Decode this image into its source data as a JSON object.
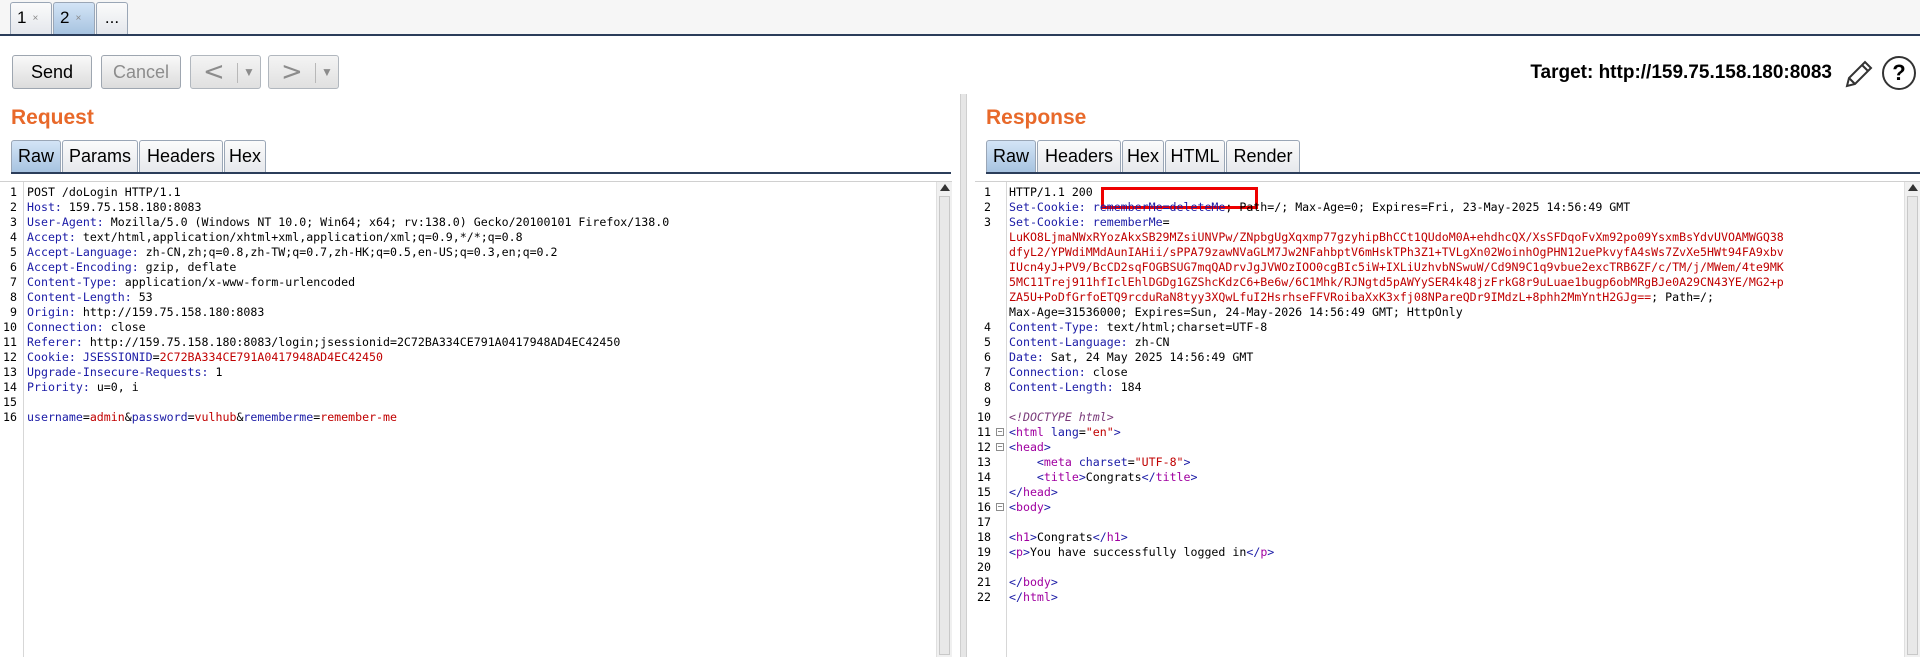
{
  "tabs": [
    {
      "label": "1",
      "close": "×"
    },
    {
      "label": "2",
      "close": "×"
    },
    {
      "label": "..."
    }
  ],
  "toolbar": {
    "send_label": "Send",
    "cancel_label": "Cancel",
    "back_arrow": "<",
    "forward_arrow": ">",
    "dropdown_glyph": "▼",
    "target_label": "Target: http://159.75.158.180:8083",
    "help_glyph": "?"
  },
  "request": {
    "title": "Request",
    "tabs": [
      "Raw",
      "Params",
      "Headers",
      "Hex"
    ],
    "active_tab": "Raw",
    "lines": [
      {
        "n": "1",
        "segments": [
          {
            "t": "POST /doLogin HTTP/1.1",
            "c": "hval"
          }
        ]
      },
      {
        "n": "2",
        "segments": [
          {
            "t": "Host: ",
            "c": "hname"
          },
          {
            "t": "159.75.158.180:8083",
            "c": "hval"
          }
        ]
      },
      {
        "n": "3",
        "segments": [
          {
            "t": "User-Agent: ",
            "c": "hname"
          },
          {
            "t": "Mozilla/5.0 (Windows NT 10.0; Win64; x64; rv:138.0) Gecko/20100101 Firefox/138.0",
            "c": "hval"
          }
        ]
      },
      {
        "n": "4",
        "segments": [
          {
            "t": "Accept: ",
            "c": "hname"
          },
          {
            "t": "text/html,application/xhtml+xml,application/xml;q=0.9,*/*;q=0.8",
            "c": "hval"
          }
        ]
      },
      {
        "n": "5",
        "segments": [
          {
            "t": "Accept-Language: ",
            "c": "hname"
          },
          {
            "t": "zh-CN,zh;q=0.8,zh-TW;q=0.7,zh-HK;q=0.5,en-US;q=0.3,en;q=0.2",
            "c": "hval"
          }
        ]
      },
      {
        "n": "6",
        "segments": [
          {
            "t": "Accept-Encoding: ",
            "c": "hname"
          },
          {
            "t": "gzip, deflate",
            "c": "hval"
          }
        ]
      },
      {
        "n": "7",
        "segments": [
          {
            "t": "Content-Type: ",
            "c": "hname"
          },
          {
            "t": "application/x-www-form-urlencoded",
            "c": "hval"
          }
        ]
      },
      {
        "n": "8",
        "segments": [
          {
            "t": "Content-Length: ",
            "c": "hname"
          },
          {
            "t": "53",
            "c": "hval"
          }
        ]
      },
      {
        "n": "9",
        "segments": [
          {
            "t": "Origin: ",
            "c": "hname"
          },
          {
            "t": "http://159.75.158.180:8083",
            "c": "hval"
          }
        ]
      },
      {
        "n": "10",
        "segments": [
          {
            "t": "Connection: ",
            "c": "hname"
          },
          {
            "t": "close",
            "c": "hval"
          }
        ]
      },
      {
        "n": "11",
        "segments": [
          {
            "t": "Referer: ",
            "c": "hname"
          },
          {
            "t": "http://159.75.158.180:8083/login;jsessionid=2C72BA334CE791A0417948AD4EC42450",
            "c": "hval"
          }
        ]
      },
      {
        "n": "12",
        "segments": [
          {
            "t": "Cookie: ",
            "c": "hname"
          },
          {
            "t": "JSESSIONID",
            "c": "blue"
          },
          {
            "t": "=",
            "c": "hval"
          },
          {
            "t": "2C72BA334CE791A0417948AD4EC42450",
            "c": "red"
          }
        ]
      },
      {
        "n": "13",
        "segments": [
          {
            "t": "Upgrade-Insecure-Requests: ",
            "c": "hname"
          },
          {
            "t": "1",
            "c": "hval"
          }
        ]
      },
      {
        "n": "14",
        "segments": [
          {
            "t": "Priority: ",
            "c": "hname"
          },
          {
            "t": "u=0, i",
            "c": "hval"
          }
        ]
      },
      {
        "n": "15",
        "segments": []
      },
      {
        "n": "16",
        "segments": [
          {
            "t": "username",
            "c": "blue"
          },
          {
            "t": "=",
            "c": "hval"
          },
          {
            "t": "admin",
            "c": "red"
          },
          {
            "t": "&",
            "c": "hval"
          },
          {
            "t": "password",
            "c": "blue"
          },
          {
            "t": "=",
            "c": "hval"
          },
          {
            "t": "vulhub",
            "c": "red"
          },
          {
            "t": "&",
            "c": "hval"
          },
          {
            "t": "rememberme",
            "c": "blue"
          },
          {
            "t": "=",
            "c": "hval"
          },
          {
            "t": "remember-me",
            "c": "red"
          }
        ]
      }
    ]
  },
  "response": {
    "title": "Response",
    "tabs": [
      "Raw",
      "Headers",
      "Hex",
      "HTML",
      "Render"
    ],
    "active_tab": "Raw",
    "lines": [
      {
        "n": "1",
        "segments": [
          {
            "t": "HTTP/1.1 200",
            "c": "hval"
          }
        ]
      },
      {
        "n": "2",
        "segments": [
          {
            "t": "Set-Cookie: ",
            "c": "hname"
          },
          {
            "t": "rememberMe=deleteMe",
            "c": "blue"
          },
          {
            "t": "; Path=/; Max-Age=0; Expires=Fri, 23-May-2025 14:56:49 GMT",
            "c": "hval"
          }
        ]
      },
      {
        "n": "3",
        "segments": [
          {
            "t": "Set-Cookie: ",
            "c": "hname"
          },
          {
            "t": "rememberMe",
            "c": "blue"
          },
          {
            "t": "=",
            "c": "hval"
          }
        ]
      },
      {
        "n": "",
        "segments": [
          {
            "t": "LuKO8LjmaNWxRYozAkxSB29MZsiUNVPw/ZNpbgUgXqxmp77gzyhipBhCCt1QUdoM0A+ehdhcQX/XsSFDqoFvXm92po09YsxmBsYdvUVOAMWGQ38",
            "c": "red"
          }
        ]
      },
      {
        "n": "",
        "segments": [
          {
            "t": "dfyL2/YPWdiMMdAunIAHii/sPPA79zawNVaGLM7Jw2NFahbptV6mHskTPh3Z1+TVLgXn02WoinhOgPHN12uePkvyfA4sWs7ZvXe5HWt94FA9xbv",
            "c": "red"
          }
        ]
      },
      {
        "n": "",
        "segments": [
          {
            "t": "IUcn4yJ+PV9/BcCD2sqFOGBSUG7mqQADrvJgJVWOzIOO0cgBIc5iW+IXLiUzhvbNSwuW/Cd9N9C1q9vbue2excTRB6ZF/c/TM/j/MWem/4te9MK",
            "c": "red"
          }
        ]
      },
      {
        "n": "",
        "segments": [
          {
            "t": "5MC11Trej911hfIclEhlDGDg1GZShcKdzC6+Be6w/6C1Mhk/RJNgtd5pAWYySER4k48jzFrkG8r9uLuae1bugp6obMRgBJe0A29CN43YE/MG2+p",
            "c": "red"
          }
        ]
      },
      {
        "n": "",
        "segments": [
          {
            "t": "ZA5U+PoDfGrfoETQ9rcduRaN8tyy3XQwLfuI2HsrhseFFVRoibaXxK3xfj08NPareQDr9IMdzL+8phh2MmYntH2GJg==",
            "c": "red"
          },
          {
            "t": "; Path=/;",
            "c": "hval"
          }
        ]
      },
      {
        "n": "",
        "segments": [
          {
            "t": "Max-Age=31536000; Expires=Sun, 24-May-2026 14:56:49 GMT; HttpOnly",
            "c": "hval"
          }
        ]
      },
      {
        "n": "4",
        "segments": [
          {
            "t": "Content-Type: ",
            "c": "hname"
          },
          {
            "t": "text/html;charset=UTF-8",
            "c": "hval"
          }
        ]
      },
      {
        "n": "5",
        "segments": [
          {
            "t": "Content-Language: ",
            "c": "hname"
          },
          {
            "t": "zh-CN",
            "c": "hval"
          }
        ]
      },
      {
        "n": "6",
        "segments": [
          {
            "t": "Date: ",
            "c": "hname"
          },
          {
            "t": "Sat, 24 May 2025 14:56:49 GMT",
            "c": "hval"
          }
        ]
      },
      {
        "n": "7",
        "segments": [
          {
            "t": "Connection: ",
            "c": "hname"
          },
          {
            "t": "close",
            "c": "hval"
          }
        ]
      },
      {
        "n": "8",
        "segments": [
          {
            "t": "Content-Length: ",
            "c": "hname"
          },
          {
            "t": "184",
            "c": "hval"
          }
        ]
      },
      {
        "n": "9",
        "segments": []
      },
      {
        "n": "10",
        "segments": [
          {
            "t": "<!DOCTYPE html>",
            "c": "comment"
          }
        ]
      },
      {
        "n": "11",
        "fold": true,
        "segments": [
          {
            "t": "<",
            "c": "blue"
          },
          {
            "t": "html",
            "c": "purple"
          },
          {
            "t": " ",
            "c": "hval"
          },
          {
            "t": "lang",
            "c": "blue"
          },
          {
            "t": "=",
            "c": "hval"
          },
          {
            "t": "\"en\"",
            "c": "red"
          },
          {
            "t": ">",
            "c": "blue"
          }
        ]
      },
      {
        "n": "12",
        "fold": true,
        "segments": [
          {
            "t": "<",
            "c": "blue"
          },
          {
            "t": "head",
            "c": "purple"
          },
          {
            "t": ">",
            "c": "blue"
          }
        ]
      },
      {
        "n": "13",
        "segments": [
          {
            "t": "    <",
            "c": "blue"
          },
          {
            "t": "meta",
            "c": "purple"
          },
          {
            "t": " ",
            "c": "hval"
          },
          {
            "t": "charset",
            "c": "blue"
          },
          {
            "t": "=",
            "c": "hval"
          },
          {
            "t": "\"UTF-8\"",
            "c": "red"
          },
          {
            "t": ">",
            "c": "blue"
          }
        ]
      },
      {
        "n": "14",
        "segments": [
          {
            "t": "    <",
            "c": "blue"
          },
          {
            "t": "title",
            "c": "purple"
          },
          {
            "t": ">",
            "c": "blue"
          },
          {
            "t": "Congrats",
            "c": "hval"
          },
          {
            "t": "</",
            "c": "blue"
          },
          {
            "t": "title",
            "c": "purple"
          },
          {
            "t": ">",
            "c": "blue"
          }
        ]
      },
      {
        "n": "15",
        "segments": [
          {
            "t": "</",
            "c": "blue"
          },
          {
            "t": "head",
            "c": "purple"
          },
          {
            "t": ">",
            "c": "blue"
          }
        ]
      },
      {
        "n": "16",
        "fold": true,
        "segments": [
          {
            "t": "<",
            "c": "blue"
          },
          {
            "t": "body",
            "c": "purple"
          },
          {
            "t": ">",
            "c": "blue"
          }
        ]
      },
      {
        "n": "17",
        "segments": []
      },
      {
        "n": "18",
        "segments": [
          {
            "t": "<",
            "c": "blue"
          },
          {
            "t": "h1",
            "c": "purple"
          },
          {
            "t": ">",
            "c": "blue"
          },
          {
            "t": "Congrats",
            "c": "hval"
          },
          {
            "t": "</",
            "c": "blue"
          },
          {
            "t": "h1",
            "c": "purple"
          },
          {
            "t": ">",
            "c": "blue"
          }
        ]
      },
      {
        "n": "19",
        "segments": [
          {
            "t": "<",
            "c": "blue"
          },
          {
            "t": "p",
            "c": "purple"
          },
          {
            "t": ">",
            "c": "blue"
          },
          {
            "t": "You have successfully logged in",
            "c": "hval"
          },
          {
            "t": "</",
            "c": "blue"
          },
          {
            "t": "p",
            "c": "purple"
          },
          {
            "t": ">",
            "c": "blue"
          }
        ]
      },
      {
        "n": "20",
        "segments": []
      },
      {
        "n": "21",
        "segments": [
          {
            "t": "</",
            "c": "blue"
          },
          {
            "t": "body",
            "c": "purple"
          },
          {
            "t": ">",
            "c": "blue"
          }
        ]
      },
      {
        "n": "22",
        "segments": [
          {
            "t": "</",
            "c": "blue"
          },
          {
            "t": "html",
            "c": "purple"
          },
          {
            "t": ">",
            "c": "blue"
          }
        ]
      }
    ]
  },
  "colors": {
    "panel_title": "#e8692a",
    "active_tab": "#a7c3e0",
    "highlight": "#ee0000"
  }
}
